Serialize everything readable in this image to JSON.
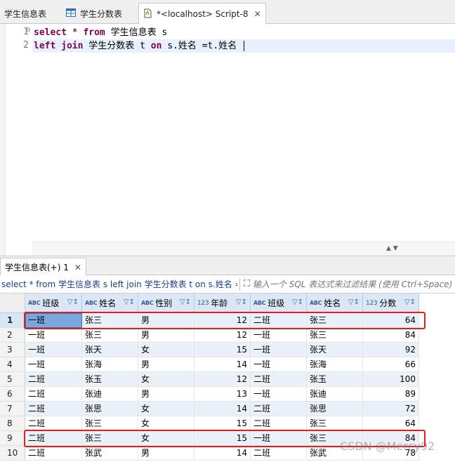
{
  "editor_tabs": [
    {
      "label": "学生信息表",
      "icon": "table-icon"
    },
    {
      "label": "学生分数表",
      "icon": "table-icon"
    },
    {
      "label": "*<localhost> Script-8",
      "icon": "sql-script-icon",
      "active": true
    }
  ],
  "editor": {
    "lines": [
      {
        "num": "1",
        "kw1": "select",
        "t1": " * ",
        "kw2": "from",
        "t2": " 学生信息表 s"
      },
      {
        "num": "2",
        "kw1": "left join",
        "t1": " 学生分数表 t ",
        "kw2": "on",
        "t2": " s.姓名 =t.姓名 "
      }
    ]
  },
  "results": {
    "tab_label": "学生信息表(+) 1",
    "query_text": "select * from 学生信息表 s left join 学生分数表 t on s.姓名 =",
    "filter_placeholder": "输入一个 SQL 表达式来过滤结果 (使用 Ctrl+Space)",
    "columns": [
      {
        "name": "班级",
        "type": "ABC"
      },
      {
        "name": "姓名",
        "type": "ABC"
      },
      {
        "name": "性别",
        "type": "ABC"
      },
      {
        "name": "年龄",
        "type": "123"
      },
      {
        "name": "班级",
        "type": "ABC"
      },
      {
        "name": "姓名",
        "type": "ABC"
      },
      {
        "name": "分数",
        "type": "123"
      }
    ],
    "rows": [
      {
        "n": "1",
        "c": [
          "一班",
          "张三",
          "男",
          "12",
          "二班",
          "张三",
          "64"
        ]
      },
      {
        "n": "2",
        "c": [
          "一班",
          "张三",
          "男",
          "12",
          "一班",
          "张三",
          "84"
        ]
      },
      {
        "n": "3",
        "c": [
          "一班",
          "张天",
          "女",
          "15",
          "一班",
          "张天",
          "92"
        ]
      },
      {
        "n": "4",
        "c": [
          "一班",
          "张海",
          "男",
          "14",
          "一班",
          "张海",
          "66"
        ]
      },
      {
        "n": "5",
        "c": [
          "二班",
          "张玉",
          "女",
          "12",
          "二班",
          "张玉",
          "100"
        ]
      },
      {
        "n": "6",
        "c": [
          "二班",
          "张迪",
          "男",
          "13",
          "一班",
          "张迪",
          "89"
        ]
      },
      {
        "n": "7",
        "c": [
          "二班",
          "张思",
          "女",
          "14",
          "二班",
          "张思",
          "72"
        ]
      },
      {
        "n": "8",
        "c": [
          "二班",
          "张三",
          "女",
          "15",
          "二班",
          "张三",
          "64"
        ]
      },
      {
        "n": "9",
        "c": [
          "二班",
          "张三",
          "女",
          "15",
          "一班",
          "张三",
          "84"
        ]
      },
      {
        "n": "10",
        "c": [
          "二班",
          "张武",
          "男",
          "14",
          "二班",
          "张武",
          "78"
        ]
      }
    ]
  },
  "watermark": "CSDN @Mercy92",
  "colors": {
    "keyword": "#7f0055",
    "header": "#dbe7f5",
    "highlight": "#e02020",
    "selected_cell": "#7aa7dc"
  }
}
